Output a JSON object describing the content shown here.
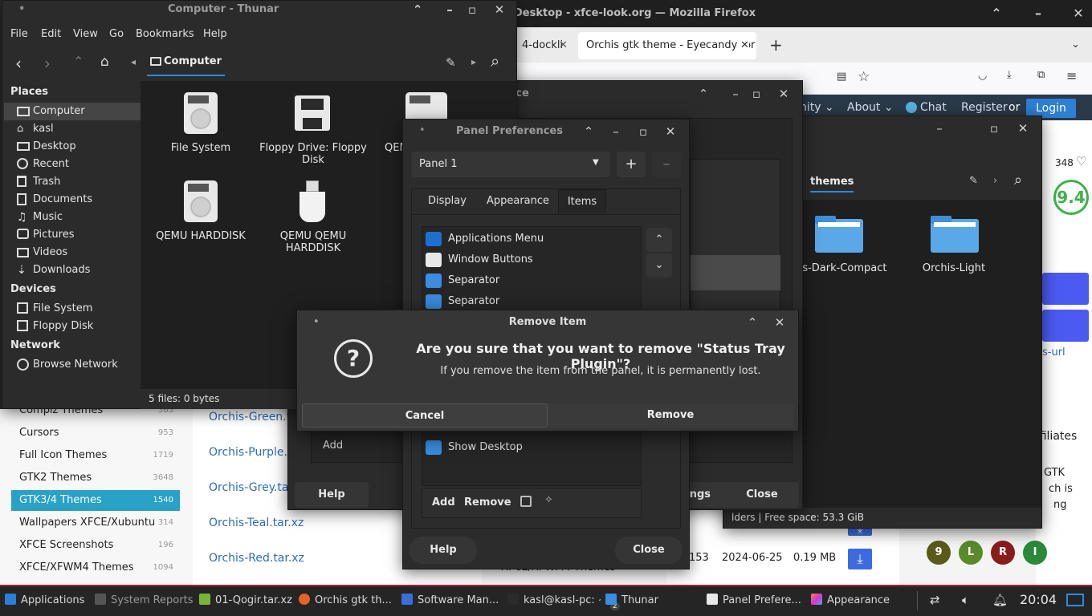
{
  "firefox": {
    "title": "Desktop - xfce-look.org — Mozilla Firefox",
    "tab_inactive": "4-dockli",
    "tab_active": "Orchis gtk theme - Eyecandy for",
    "nav_links": [
      "nity ⌄",
      "About ⌄",
      "Chat",
      "Register",
      "or"
    ],
    "login": "Login",
    "likes": "348",
    "score": "9.4",
    "side_link": "s-url",
    "affiliates": "ffiliates",
    "gtk_text": [
      "GTK",
      "ch is",
      "ng"
    ],
    "categories": [
      {
        "label": "Compiz Themes",
        "count": "365"
      },
      {
        "label": "Cursors",
        "count": "953"
      },
      {
        "label": "Full Icon Themes",
        "count": "1719"
      },
      {
        "label": "GTK2 Themes",
        "count": "3648"
      },
      {
        "label": "GTK3/4 Themes",
        "count": "1540"
      },
      {
        "label": "Wallpapers XFCE/Xubuntu",
        "count": "314"
      },
      {
        "label": "XFCE Screenshots",
        "count": "196"
      },
      {
        "label": "XFCE/XFWM4 Themes",
        "count": "1094"
      }
    ],
    "files": [
      "Orchis-Green.ta",
      "Orchis-Purple.t",
      "Orchis-Grey.tar",
      "Orchis-Teal.tar.xz",
      "Orchis-Red.tar.xz"
    ],
    "red_row": {
      "downloads": "153",
      "date": "2024-06-25",
      "size": "0.19 MB"
    },
    "circles": [
      {
        "letter": "9",
        "color": "#5a5a1a"
      },
      {
        "letter": "L",
        "color": "#5a8a2a"
      },
      {
        "letter": "R",
        "color": "#8a1c1c"
      },
      {
        "letter": "I",
        "color": "#2a8a3a"
      }
    ]
  },
  "thunar": {
    "title": "Computer - Thunar",
    "menu": [
      "File",
      "Edit",
      "View",
      "Go",
      "Bookmarks",
      "Help"
    ],
    "location": "Computer",
    "places_header": "Places",
    "places": [
      "Computer",
      "kasl",
      "Desktop",
      "Recent",
      "Trash",
      "Documents",
      "Music",
      "Pictures",
      "Videos",
      "Downloads"
    ],
    "devices_header": "Devices",
    "devices": [
      "File System",
      "Floppy Disk"
    ],
    "network_header": "Network",
    "network": [
      "Browse Network"
    ],
    "files": [
      {
        "name": "File System"
      },
      {
        "name": "Floppy Drive: Floppy Disk"
      },
      {
        "name": "QEM"
      },
      {
        "name": "QEMU HARDDISK"
      },
      {
        "name": "QEMU QEMU HARDDISK"
      }
    ],
    "status": "5 files: 0 bytes"
  },
  "themes_window": {
    "location": "themes",
    "folders": [
      "his-Dark-Compact",
      "Orchis-Light"
    ],
    "status": "lders  |  Free space: 53.3 GiB",
    "settings_btn": "ings",
    "close": "Close"
  },
  "settings_window": {
    "title": "nce",
    "add": "Add",
    "help": "Help"
  },
  "panel_prefs": {
    "title": "Panel Preferences",
    "panel_select": "Panel 1",
    "tabs": [
      "Display",
      "Appearance",
      "Items"
    ],
    "items": [
      "Applications Menu",
      "Window Buttons",
      "Separator",
      "Separator"
    ],
    "item_bottom": "Show Desktop",
    "footer_add": "Add",
    "footer_remove": "Remove",
    "help": "Help",
    "close": "Close"
  },
  "remove_dialog": {
    "title": "Remove Item",
    "question": "Are you sure that you want to remove \"Status Tray Plugin\"?",
    "subtext": "If you remove the item from the panel, it is permanently lost.",
    "cancel": "Cancel",
    "remove": "Remove"
  },
  "taskbar": {
    "items": [
      "Applications",
      "System Reports",
      "01-Qogir.tar.xz",
      "Orchis gtk th...",
      "Software Man...",
      "kasl@kasl-pc: ~",
      "Thunar",
      "Panel Prefere...",
      "Appearance"
    ],
    "badge": "2",
    "clock": "20:04"
  }
}
